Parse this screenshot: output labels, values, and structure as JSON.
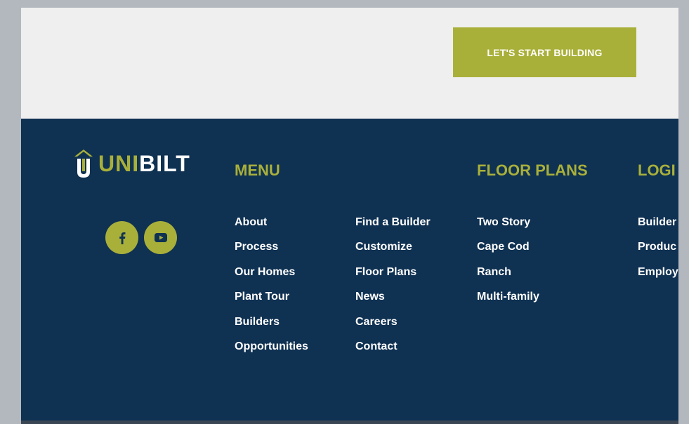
{
  "cta": {
    "label": "LET'S START BUILDING"
  },
  "logo": {
    "text_uni": "UNI",
    "text_bilt": "BILT"
  },
  "social": {
    "icons": [
      "facebook-icon",
      "youtube-icon"
    ]
  },
  "footer": {
    "menu_heading": "MENU",
    "menu_col1": [
      "About",
      "Process",
      "Our Homes",
      "Plant Tour",
      "Builders",
      "Opportunities"
    ],
    "menu_col2": [
      "Find a Builder",
      "Customize",
      "Floor Plans",
      "News",
      "Careers",
      "Contact"
    ],
    "floor_plans_heading": "FLOOR PLANS",
    "floor_plans": [
      "Two Story",
      "Cape Cod",
      "Ranch",
      "Multi-family"
    ],
    "login_heading": "LOGI",
    "login_links": [
      "Builder",
      "Produc",
      "Employ"
    ]
  },
  "colors": {
    "accent": "#a9b03a",
    "footer_bg": "#0f3152",
    "cta_band_bg": "#efefef",
    "outer_bg": "#b3b8bf"
  }
}
